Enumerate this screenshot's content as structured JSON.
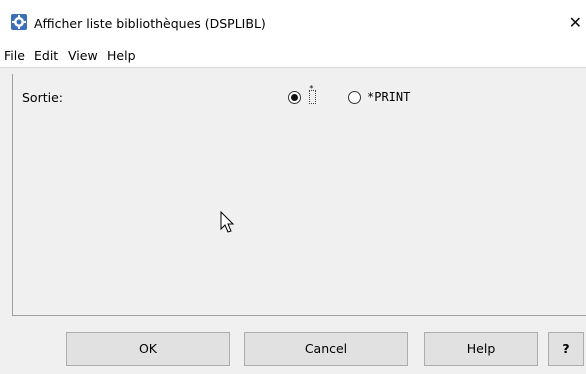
{
  "window": {
    "title": "Afficher liste bibliothèques (DSPLIBL)",
    "close_label": "✕",
    "app_icon": "command-icon"
  },
  "menu": {
    "items": [
      "File",
      "Edit",
      "View",
      "Help"
    ]
  },
  "form": {
    "output_label": "Sortie:",
    "options": [
      {
        "label": "*",
        "checked": true
      },
      {
        "label": "*PRINT",
        "checked": false
      }
    ]
  },
  "buttons": {
    "ok": "OK",
    "cancel": "Cancel",
    "help": "Help",
    "help_question": "?"
  },
  "icons": {
    "cursor": "mouse-pointer-icon"
  },
  "colors": {
    "window_bg": "#f0f0f0",
    "button_bg": "#e1e1e1",
    "button_border": "#adadad"
  }
}
